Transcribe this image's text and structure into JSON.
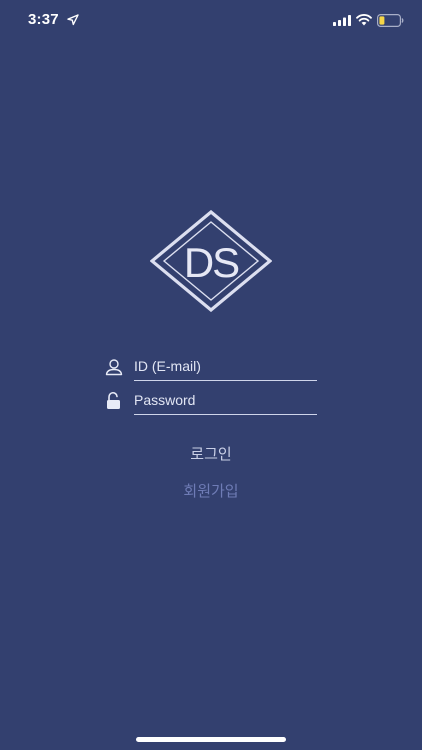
{
  "status_bar": {
    "time": "3:37",
    "icons": [
      "location-arrow-icon",
      "signal-icon",
      "wifi-icon",
      "battery-low-icon"
    ]
  },
  "logo": {
    "text": "DS"
  },
  "form": {
    "id_placeholder": "ID (E-mail)",
    "id_icon": "user-icon",
    "password_placeholder": "Password",
    "password_icon": "unlock-icon"
  },
  "actions": {
    "login_label": "로그인",
    "signup_label": "회원가입"
  },
  "colors": {
    "background": "#33406f",
    "signup_text": "#6f7cb6",
    "battery_level": "#f5d547"
  }
}
